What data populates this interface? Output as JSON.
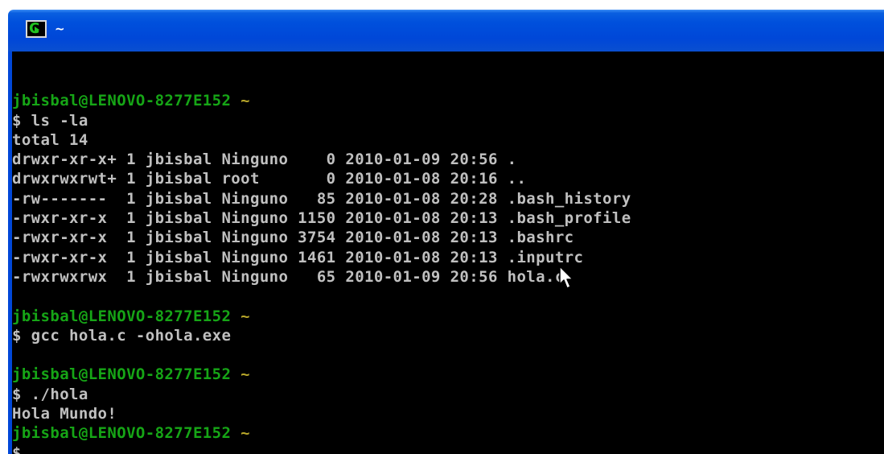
{
  "window": {
    "title": "~",
    "icon": "cygwin-terminal-icon"
  },
  "colors": {
    "titlebar": "#0050dc",
    "background": "#000000",
    "text": "#c0c0c0",
    "prompt_user": "#16a516",
    "prompt_dir": "#b8a72a"
  },
  "terminal": {
    "lines": [
      {
        "type": "blank",
        "text": ""
      },
      {
        "type": "prompt",
        "user": "jbisbal@LENOVO-8277E152",
        "dir": "~"
      },
      {
        "type": "text",
        "text": "$ ls -la"
      },
      {
        "type": "text",
        "text": "total 14"
      },
      {
        "type": "text",
        "text": "drwxr-xr-x+ 1 jbisbal Ninguno    0 2010-01-09 20:56 ."
      },
      {
        "type": "text",
        "text": "drwxrwxrwt+ 1 jbisbal root       0 2010-01-08 20:16 .."
      },
      {
        "type": "text",
        "text": "-rw-------  1 jbisbal Ninguno   85 2010-01-08 20:28 .bash_history"
      },
      {
        "type": "text",
        "text": "-rwxr-xr-x  1 jbisbal Ninguno 1150 2010-01-08 20:13 .bash_profile"
      },
      {
        "type": "text",
        "text": "-rwxr-xr-x  1 jbisbal Ninguno 3754 2010-01-08 20:13 .bashrc"
      },
      {
        "type": "text",
        "text": "-rwxr-xr-x  1 jbisbal Ninguno 1461 2010-01-08 20:13 .inputrc"
      },
      {
        "type": "text",
        "text": "-rwxrwxrwx  1 jbisbal Ninguno   65 2010-01-09 20:56 hola.c"
      },
      {
        "type": "blank",
        "text": ""
      },
      {
        "type": "prompt",
        "user": "jbisbal@LENOVO-8277E152",
        "dir": "~"
      },
      {
        "type": "text",
        "text": "$ gcc hola.c -ohola.exe"
      },
      {
        "type": "blank",
        "text": ""
      },
      {
        "type": "prompt",
        "user": "jbisbal@LENOVO-8277E152",
        "dir": "~"
      },
      {
        "type": "text",
        "text": "$ ./hola"
      },
      {
        "type": "text",
        "text": "Hola Mundo!"
      },
      {
        "type": "prompt",
        "user": "jbisbal@LENOVO-8277E152",
        "dir": "~"
      },
      {
        "type": "text",
        "text": "$"
      }
    ]
  }
}
